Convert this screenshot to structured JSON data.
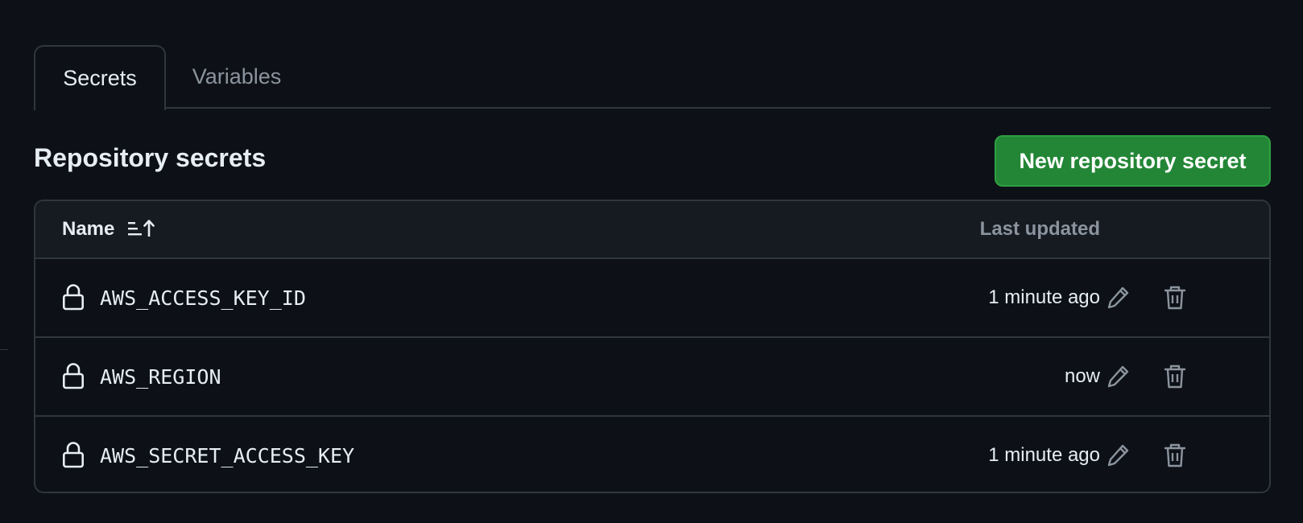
{
  "tabs": {
    "secrets": "Secrets",
    "variables": "Variables"
  },
  "section": {
    "title": "Repository secrets",
    "new_button": "New repository secret"
  },
  "table": {
    "headers": {
      "name": "Name",
      "last_updated": "Last updated"
    },
    "rows": [
      {
        "name": "AWS_ACCESS_KEY_ID",
        "updated": "1 minute ago"
      },
      {
        "name": "AWS_REGION",
        "updated": "now"
      },
      {
        "name": "AWS_SECRET_ACCESS_KEY",
        "updated": "1 minute ago"
      }
    ]
  },
  "icons": {
    "lock": "lock-icon",
    "edit": "pencil-icon",
    "delete": "trash-icon",
    "sort": "sort-ascending-icon"
  },
  "colors": {
    "background": "#0d1117",
    "primary_button": "#238636",
    "border": "#30363d",
    "muted_text": "#8b949e"
  }
}
